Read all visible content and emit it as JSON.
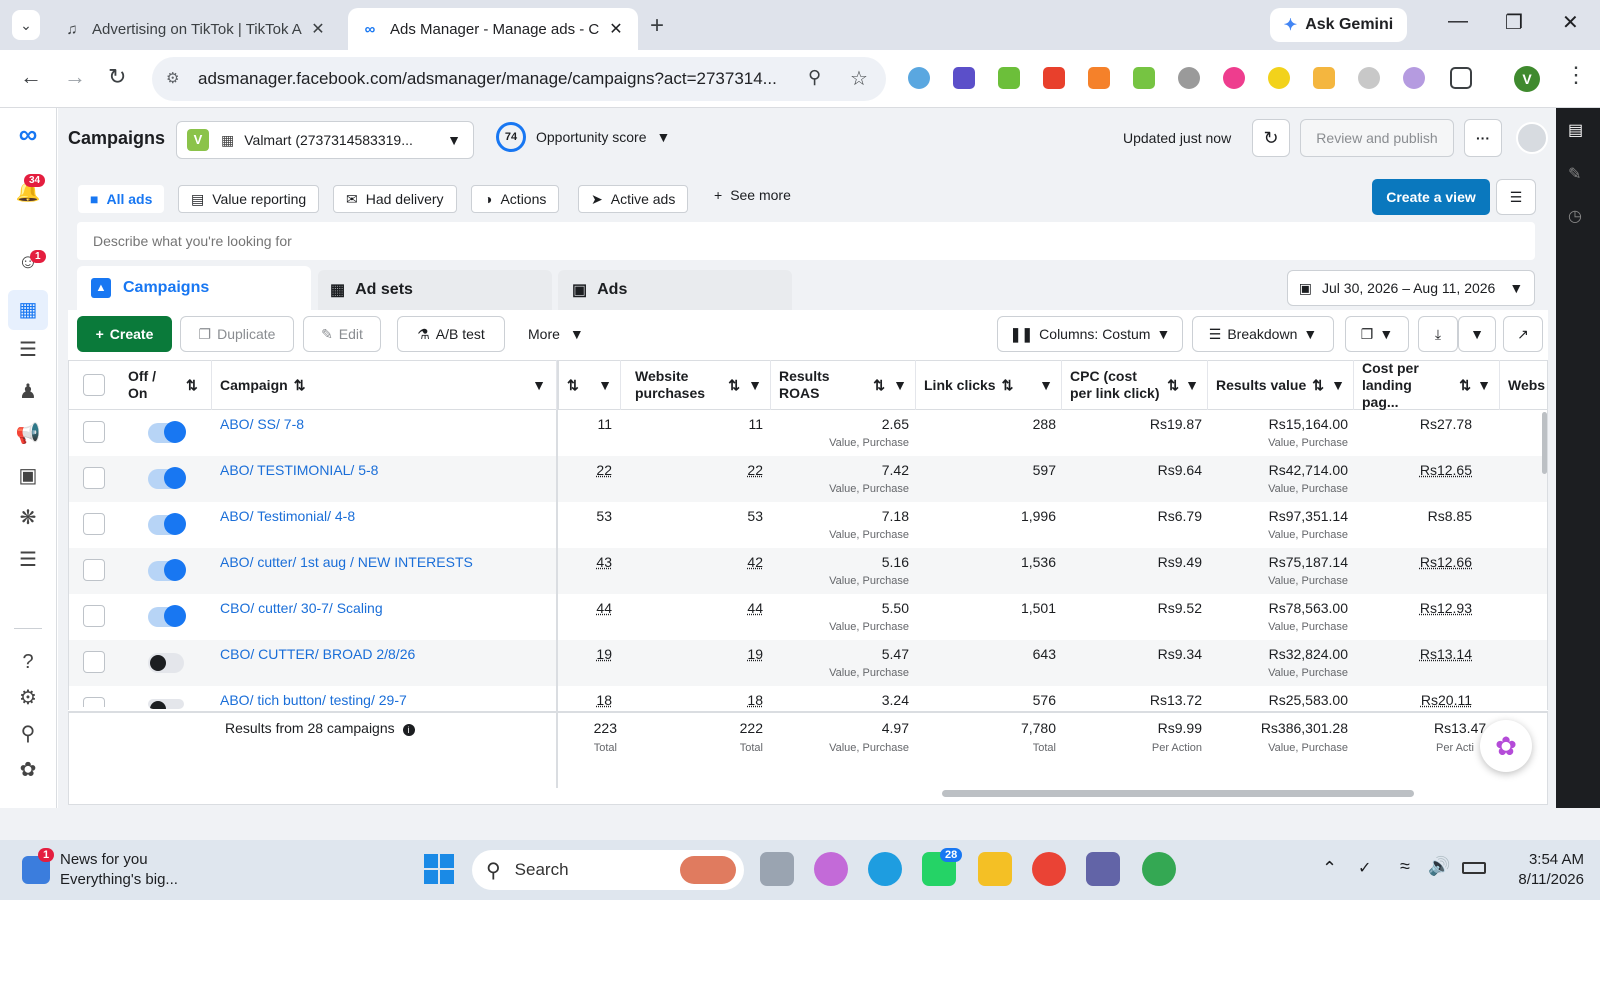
{
  "browser": {
    "tabs": [
      {
        "title": "Advertising on TikTok | TikTok A",
        "active": false
      },
      {
        "title": "Ads Manager - Manage ads - C",
        "active": true
      }
    ],
    "ask_gemini": "Ask Gemini",
    "url": "adsmanager.facebook.com/adsmanager/manage/campaigns?act=2737314...",
    "profile_initial": "V"
  },
  "rail": {
    "notif_badge": "34",
    "alerts_badge": "1"
  },
  "header": {
    "title": "Campaigns",
    "account_initial": "V",
    "account": "Valmart (2737314583319...",
    "opp_score": "74",
    "opp_label": "Opportunity score",
    "updated": "Updated just now",
    "review_publish": "Review and publish",
    "more": "···"
  },
  "views": {
    "items": [
      "All ads",
      "Value reporting",
      "Had delivery",
      "Actions",
      "Active ads"
    ],
    "see_more": "See more",
    "create_view": "Create a view"
  },
  "search": {
    "placeholder": "Describe what you're looking for"
  },
  "level_tabs": [
    "Campaigns",
    "Ad sets",
    "Ads"
  ],
  "date_range": "Jul 30, 2026 – Aug 11, 2026",
  "toolbar": {
    "create": "Create",
    "duplicate": "Duplicate",
    "edit": "Edit",
    "ab_test": "A/B test",
    "more": "More",
    "columns": "Columns: Costum",
    "breakdown": "Breakdown"
  },
  "table": {
    "columns": [
      "Off / On",
      "Campaign",
      "Website purchases",
      "Results ROAS",
      "Link clicks",
      "CPC (cost per link click)",
      "Results value",
      "Cost per landing pag...",
      "Websi landin"
    ],
    "rows": [
      {
        "campaign": "ABO/ SS/ 7-8",
        "on": true,
        "c1": "11",
        "purchases": "11",
        "roas": "2.65",
        "clicks": "288",
        "cpc": "Rs19.87",
        "value": "Rs15,164.00",
        "cplp": "Rs27.78"
      },
      {
        "campaign": "ABO/ TESTIMONIAL/ 5-8",
        "on": true,
        "c1": "22",
        "purchases": "22",
        "roas": "7.42",
        "clicks": "597",
        "cpc": "Rs9.64",
        "value": "Rs42,714.00",
        "cplp": "Rs12.65"
      },
      {
        "campaign": "ABO/ Testimonial/ 4-8",
        "on": true,
        "c1": "53",
        "purchases": "53",
        "roas": "7.18",
        "clicks": "1,996",
        "cpc": "Rs6.79",
        "value": "Rs97,351.14",
        "cplp": "Rs8.85"
      },
      {
        "campaign": "ABO/ cutter/ 1st aug / NEW INTERESTS",
        "on": true,
        "c1": "43",
        "purchases": "42",
        "roas": "5.16",
        "clicks": "1,536",
        "cpc": "Rs9.49",
        "value": "Rs75,187.14",
        "cplp": "Rs12.66"
      },
      {
        "campaign": "CBO/ cutter/ 30-7/ Scaling",
        "on": true,
        "c1": "44",
        "purchases": "44",
        "roas": "5.50",
        "clicks": "1,501",
        "cpc": "Rs9.52",
        "value": "Rs78,563.00",
        "cplp": "Rs12.93"
      },
      {
        "campaign": "CBO/ CUTTER/ BROAD 2/8/26",
        "on": false,
        "c1": "19",
        "purchases": "19",
        "roas": "5.47",
        "clicks": "643",
        "cpc": "Rs9.34",
        "value": "Rs32,824.00",
        "cplp": "Rs13.14"
      },
      {
        "campaign": "ABO/ tich button/ testing/ 29-7",
        "on": false,
        "c1": "18",
        "purchases": "18",
        "roas": "3.24",
        "clicks": "576",
        "cpc": "Rs13.72",
        "value": "Rs25,583.00",
        "cplp": "Rs20.11"
      }
    ],
    "value_sub": "Value, Purchase",
    "summary": {
      "label": "Results from 28 campaigns",
      "c1": "223",
      "c1_sub": "Total",
      "purchases": "222",
      "purchases_sub": "Total",
      "roas": "4.97",
      "roas_sub": "Value, Purchase",
      "clicks": "7,780",
      "clicks_sub": "Total",
      "cpc": "Rs9.99",
      "cpc_sub": "Per Action",
      "value": "Rs386,301.28",
      "value_sub": "Value, Purchase",
      "cplp": "Rs13.47",
      "cplp_sub": "Per Acti"
    }
  },
  "taskbar": {
    "news_title": "News for you",
    "news_sub": "Everything's big...",
    "news_badge": "1",
    "search": "Search",
    "whatsapp_badge": "28",
    "time": "3:54 AM",
    "date": "8/11/2026"
  }
}
